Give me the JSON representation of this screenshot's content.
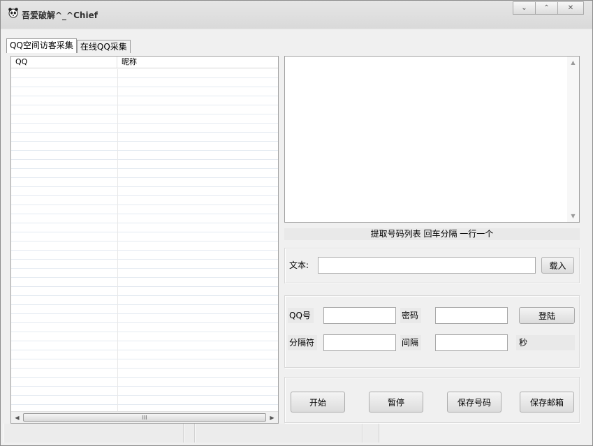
{
  "window": {
    "title": "吾爱破解^_^Chief",
    "icon": "panda-icon",
    "controls": {
      "minimize": "⌄",
      "maximize": "⌃",
      "close": "✕"
    }
  },
  "tabs": [
    {
      "label": "QQ空间访客采集",
      "active": true
    },
    {
      "label": "在线QQ采集",
      "active": false
    }
  ],
  "list": {
    "columns": [
      "QQ",
      "昵称"
    ],
    "rows": [],
    "scroll_thumb_grip": "III"
  },
  "hint": "提取号码列表  回车分隔   一行一个",
  "load_group": {
    "text_label": "文本:",
    "text_value": "",
    "load_button": "载入"
  },
  "login_group": {
    "qq_label": "QQ号",
    "qq_value": "",
    "password_label": "密码",
    "password_value": "",
    "login_button": "登陆",
    "separator_label": "分隔符",
    "separator_value": "",
    "interval_label": "间隔",
    "interval_value": "",
    "seconds_label": "秒"
  },
  "actions": {
    "start": "开始",
    "pause": "暂停",
    "save_numbers": "保存号码",
    "save_emails": "保存邮箱"
  },
  "statusbar": {
    "panels": [
      "",
      "",
      "",
      ""
    ]
  }
}
